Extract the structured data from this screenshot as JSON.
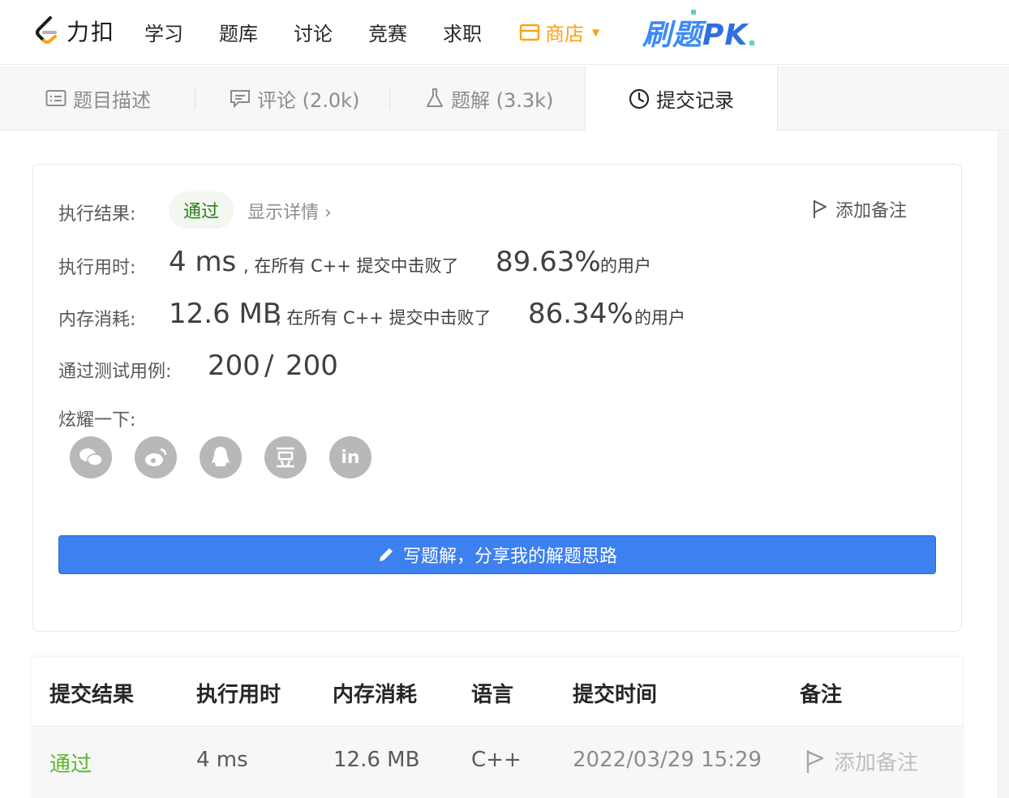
{
  "nav": {
    "brand": "力扣",
    "items": [
      "学习",
      "题库",
      "讨论",
      "竞赛",
      "求职"
    ],
    "store": "商店",
    "pk_prefix": "刷题",
    "pk_suffix": "PK"
  },
  "tabs": {
    "description": "题目描述",
    "comments": "评论 (2.0k)",
    "solutions": "题解 (3.3k)",
    "submissions": "提交记录"
  },
  "result": {
    "status_label": "执行结果:",
    "status": "通过",
    "details": "显示详情 ›",
    "add_note": "添加备注",
    "runtime_label": "执行用时:",
    "runtime_value": "4 ms",
    "runtime_text": ", 在所有 C++ 提交中击败了",
    "runtime_percent": "89.63%",
    "runtime_users": "的用户",
    "memory_label": "内存消耗:",
    "memory_value": "12.6 MB",
    "memory_text": ", 在所有 C++ 提交中击败了",
    "memory_percent": "86.34%",
    "memory_users": "的用户",
    "tests_label": "通过测试用例:",
    "tests_passed": "200",
    "tests_sep": "/",
    "tests_total": "200",
    "share_label": "炫耀一下:",
    "share_icons": [
      "wechat-icon",
      "weibo-icon",
      "qq-icon",
      "douban-icon",
      "linkedin-icon"
    ],
    "write_button": "写题解，分享我的解题思路"
  },
  "table": {
    "headers": [
      "提交结果",
      "执行用时",
      "内存消耗",
      "语言",
      "提交时间",
      "备注"
    ],
    "rows": [
      {
        "result": "通过",
        "runtime": "4 ms",
        "memory": "12.6 MB",
        "language": "C++",
        "time": "2022/03/29 15:29",
        "note": "添加备注"
      }
    ]
  },
  "colors": {
    "accent": "#3d80f0",
    "store": "#ffa116",
    "pass": "#5cb531"
  }
}
